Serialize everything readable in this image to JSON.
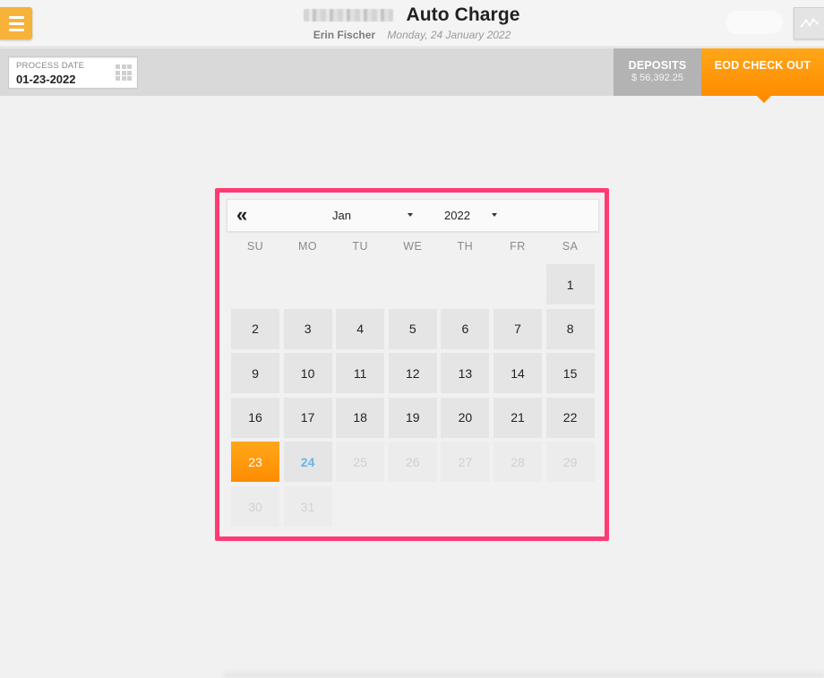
{
  "header": {
    "title": "Auto Charge",
    "user": "Erin Fischer",
    "date": "Monday, 24 January 2022"
  },
  "subbar": {
    "process_date_label": "PROCESS DATE",
    "process_date_value": "01-23-2022",
    "deposits_label": "DEPOSITS",
    "deposits_amount": "$ 56,392.25",
    "eod_label": "EOD CHECK OUT"
  },
  "calendar": {
    "prev_label": "«",
    "month": "Jan",
    "year": "2022",
    "weekdays": [
      "SU",
      "MO",
      "TU",
      "WE",
      "TH",
      "FR",
      "SA"
    ],
    "days": [
      {
        "d": "1",
        "state": "normal"
      },
      {
        "d": "2",
        "state": "normal"
      },
      {
        "d": "3",
        "state": "normal"
      },
      {
        "d": "4",
        "state": "normal"
      },
      {
        "d": "5",
        "state": "normal"
      },
      {
        "d": "6",
        "state": "normal"
      },
      {
        "d": "7",
        "state": "normal"
      },
      {
        "d": "8",
        "state": "normal"
      },
      {
        "d": "9",
        "state": "normal"
      },
      {
        "d": "10",
        "state": "normal"
      },
      {
        "d": "11",
        "state": "normal"
      },
      {
        "d": "12",
        "state": "normal"
      },
      {
        "d": "13",
        "state": "normal"
      },
      {
        "d": "14",
        "state": "normal"
      },
      {
        "d": "15",
        "state": "normal"
      },
      {
        "d": "16",
        "state": "normal"
      },
      {
        "d": "17",
        "state": "normal"
      },
      {
        "d": "18",
        "state": "normal"
      },
      {
        "d": "19",
        "state": "normal"
      },
      {
        "d": "20",
        "state": "normal"
      },
      {
        "d": "21",
        "state": "normal"
      },
      {
        "d": "22",
        "state": "normal"
      },
      {
        "d": "23",
        "state": "selected"
      },
      {
        "d": "24",
        "state": "today"
      },
      {
        "d": "25",
        "state": "disabled"
      },
      {
        "d": "26",
        "state": "disabled"
      },
      {
        "d": "27",
        "state": "disabled"
      },
      {
        "d": "28",
        "state": "disabled"
      },
      {
        "d": "29",
        "state": "disabled"
      },
      {
        "d": "30",
        "state": "disabled"
      },
      {
        "d": "31",
        "state": "disabled"
      }
    ]
  },
  "icons": {
    "menu": "hamburger-menu-icon",
    "chart": "line-chart-icon",
    "calendar_grid": "calendar-grid-icon",
    "prev": "double-chevron-left-icon",
    "dropdown": "caret-down-icon"
  },
  "colors": {
    "accent_orange": "#ff8c00",
    "menu_yellow": "#f7b23a",
    "highlight_frame": "#ff3b73",
    "today_blue": "#6ab4e8"
  }
}
